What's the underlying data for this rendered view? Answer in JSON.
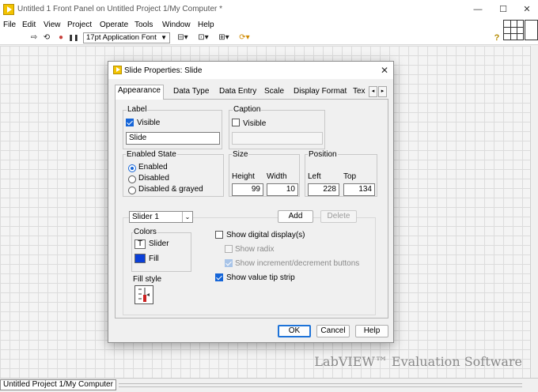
{
  "window": {
    "title": "Untitled 1 Front Panel on Untitled Project 1/My Computer *",
    "minimize": "—",
    "maximize": "☐",
    "close": "✕"
  },
  "menu": [
    "File",
    "Edit",
    "View",
    "Project",
    "Operate",
    "Tools",
    "Window",
    "Help"
  ],
  "toolbar": {
    "run_arrow": "⇨",
    "run_continuous": "⟲",
    "abort": "●",
    "pause": "❚❚",
    "font": "17pt Application Font",
    "align": "⊟▾",
    "distribute": "⊡▾",
    "resize": "⊞▾",
    "reorder": "⟳▾",
    "help": "?"
  },
  "dialog": {
    "title": "Slide Properties: Slide",
    "close": "✕",
    "tabs": [
      "Appearance",
      "Data Type",
      "Data Entry",
      "Scale",
      "Display Format",
      "Tex"
    ],
    "tab_scroll_left": "◂",
    "tab_scroll_right": "▸",
    "label_group": {
      "title": "Label",
      "visible_label": "Visible",
      "visible_checked": true,
      "value": "Slide"
    },
    "caption_group": {
      "title": "Caption",
      "visible_label": "Visible",
      "visible_checked": false,
      "value": ""
    },
    "enabled_state": {
      "title": "Enabled State",
      "options": [
        "Enabled",
        "Disabled",
        "Disabled & grayed"
      ],
      "selected": "Enabled"
    },
    "size": {
      "title": "Size",
      "height_label": "Height",
      "width_label": "Width",
      "height": "99",
      "width": "10"
    },
    "position": {
      "title": "Position",
      "left_label": "Left",
      "top_label": "Top",
      "left": "228",
      "top": "134"
    },
    "slider_select": "Slider 1",
    "add_button": "Add",
    "delete_button": "Delete",
    "colors": {
      "title": "Colors",
      "slider_label": "Slider",
      "slider_glyph": "T",
      "fill_label": "Fill",
      "fill_color": "#0a3fd8"
    },
    "fill_style_label": "Fill style",
    "options": [
      {
        "label": "Show digital display(s)",
        "checked": false,
        "enabled": true
      },
      {
        "label": "Show radix",
        "checked": false,
        "enabled": false
      },
      {
        "label": "Show increment/decrement buttons",
        "checked": true,
        "enabled": false
      },
      {
        "label": "Show value tip strip",
        "checked": true,
        "enabled": true
      }
    ],
    "ok_button": "OK",
    "cancel_button": "Cancel",
    "help_button": "Help"
  },
  "watermark": "LabVIEW™ Evaluation Software",
  "status": {
    "project": "Untitled Project 1/My Computer"
  },
  "colors": {
    "accent": "#1565d8",
    "labview_yellow": "#f3c300"
  }
}
